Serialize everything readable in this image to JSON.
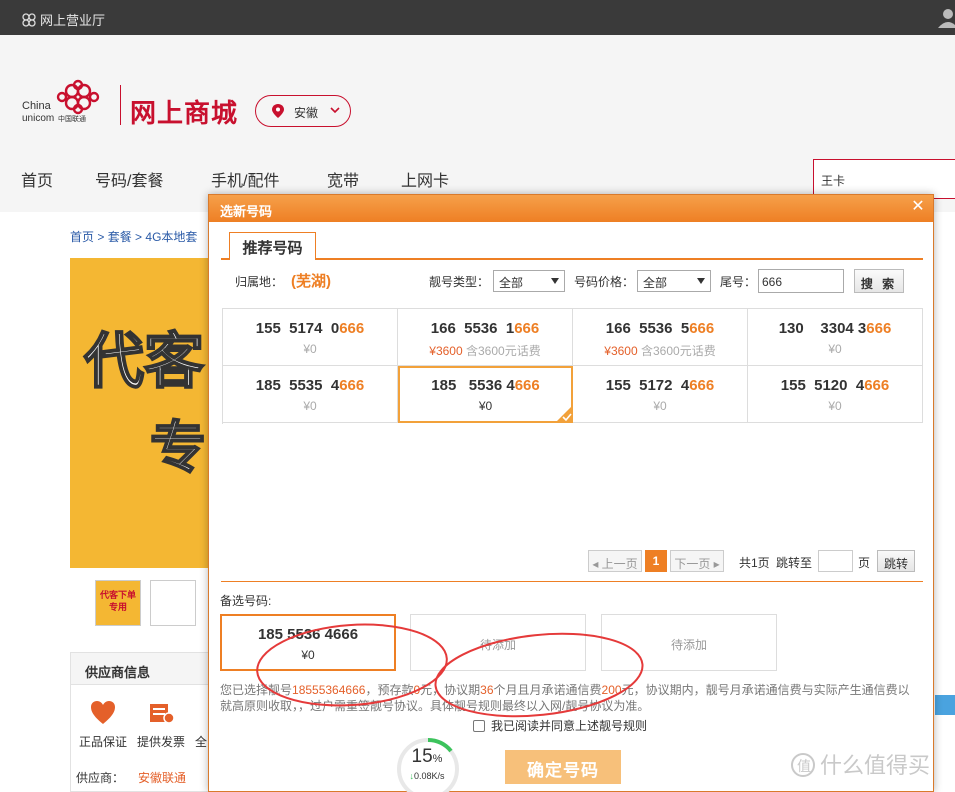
{
  "topbar": {
    "site_name": "网上营业厅"
  },
  "header": {
    "logo_text": "China unicom中国联通",
    "mall_title": "网上商城",
    "province": "安徽",
    "nav": [
      "首页",
      "号码/套餐",
      "手机/配件",
      "宽带",
      "上网卡"
    ],
    "search_value": "王卡"
  },
  "page": {
    "breadcrumb": [
      "首页",
      "套餐",
      "4G本地套"
    ],
    "banner_text": [
      "代客",
      "专"
    ],
    "thumb_text": "代客下单专用",
    "supplier": {
      "title": "供应商信息",
      "items": [
        "正品保证",
        "提供发票",
        "全"
      ],
      "provider_label": "供应商：",
      "provider_value": "安徽联通"
    }
  },
  "modal": {
    "title": "选新号码",
    "tab": "推荐号码",
    "filters": {
      "region_label": "归属地：",
      "region_value": "(芜湖)",
      "type_label": "靓号类型：",
      "type_value": "全部",
      "price_label": "号码价格：",
      "price_value": "全部",
      "tail_label": "尾号：",
      "tail_value": "666",
      "search_button": "搜 索"
    },
    "numbers": [
      {
        "prefix": "155  5174  0",
        "tail": "666",
        "price": "¥0",
        "deposit": "",
        "note": "",
        "selected": false
      },
      {
        "prefix": "166  5536  1",
        "tail": "666",
        "price": "¥3600",
        "deposit": "含3600",
        "note": "元话费",
        "selected": false
      },
      {
        "prefix": "166  5536  5",
        "tail": "666",
        "price": "¥3600",
        "deposit": "含3600",
        "note": "元话费",
        "selected": false
      },
      {
        "prefix": "130    3304 3",
        "tail": "666",
        "price": "¥0",
        "deposit": "",
        "note": "",
        "selected": false
      },
      {
        "prefix": "185  5535  4",
        "tail": "666",
        "price": "¥0",
        "deposit": "",
        "note": "",
        "selected": false
      },
      {
        "prefix": "185   5536 4",
        "tail": "666",
        "price": "¥0",
        "deposit": "",
        "note": "",
        "selected": true
      },
      {
        "prefix": "155  5172  4",
        "tail": "666",
        "price": "¥0",
        "deposit": "",
        "note": "",
        "selected": false
      },
      {
        "prefix": "155  5120  4",
        "tail": "666",
        "price": "¥0",
        "deposit": "",
        "note": "",
        "selected": false
      }
    ],
    "pager": {
      "prev": "上一页",
      "current": "1",
      "next": "下一页",
      "total": "共1页",
      "jump_label": "跳转至",
      "page_unit": "页",
      "go": "跳转"
    },
    "backup": {
      "label": "备选号码:",
      "selected_number": "185 5536 4666",
      "selected_price": "¥0",
      "pending1": "待添加",
      "pending2": "待添加"
    },
    "notice": {
      "p1": "您已选择靓号",
      "num": "18555364666",
      "p2": "，预存款",
      "deposit": "0",
      "p3": "元，协议期",
      "months": "36",
      "p4": "个月且月承诺通信费",
      "fee": "200",
      "p5": "元，协议期内，靓号月承诺通信费与实际产生通信费以就高原则收取，，过户需重签靓号协议。具体靓号规则最终以入网/靓号协议为准。"
    },
    "agree_text": "我已阅读并同意上述靓号规则",
    "confirm_button": "确定号码"
  },
  "speed": {
    "percent": "15",
    "unit": "%",
    "rate": "0.08K/s"
  },
  "watermark": "值 什么值得买",
  "colors": {
    "accent": "#ee7f24",
    "brand_red": "#c8102e",
    "annotation": "#e53a3a"
  }
}
